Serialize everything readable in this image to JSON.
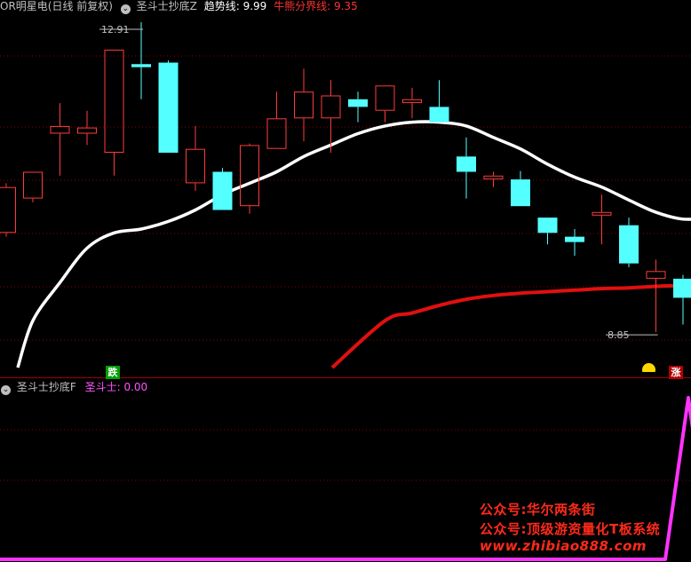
{
  "header": {
    "main": {
      "stock_title": "OR明星电(日线 前复权)",
      "indicator_name": "圣斗士抄底Z",
      "trend_label": "趋势线:",
      "trend_value": "9.99",
      "bull_bear_label": "牛熊分界线:",
      "bull_bear_value": "9.35"
    },
    "sub": {
      "indicator_name": "圣斗士抄底F",
      "series_label": "圣斗士:",
      "series_value": "0.00"
    }
  },
  "markers": {
    "drop": "跌",
    "rise": "涨"
  },
  "watermark": {
    "line1": "公众号:华尔两条街",
    "line2": "公众号:顶级游资量化T板系统",
    "line3": "www.zhibiao888.com"
  },
  "colors": {
    "background": "#000000",
    "up_candle": "#ff3b3b",
    "down_candle": "#54ffff",
    "trend_line": "#ffffff",
    "bull_bear_line": "#e01010",
    "signal_line": "#ff33ff",
    "grid": "#8b0000",
    "label_gray": "#c0c0c0",
    "label_white": "#ffffff",
    "label_red": "#ff3333",
    "label_magenta": "#ff55ff",
    "drop_marker_bg": "#00a000",
    "rise_marker_bg": "#b00000"
  },
  "chart_data": [
    {
      "type": "candlestick",
      "title": "OR明星电(日线 前复权)",
      "candles": [
        {
          "open": 10.6,
          "close": 10.95,
          "high": 10.95,
          "low": 10.55
        },
        {
          "open": 11.45,
          "close": 11.55,
          "high": 11.85,
          "low": 10.9
        },
        {
          "open": 11.45,
          "close": 11.53,
          "high": 11.75,
          "low": 11.3
        },
        {
          "open": 11.2,
          "close": 12.55,
          "high": 12.55,
          "low": 10.9
        },
        {
          "open": 12.36,
          "close": 12.32,
          "high": 12.91,
          "low": 11.9
        },
        {
          "open": 12.38,
          "close": 11.2,
          "high": 12.41,
          "low": 11.2
        },
        {
          "open": 10.8,
          "close": 11.25,
          "high": 11.55,
          "low": 10.7
        },
        {
          "open": 10.95,
          "close": 10.45,
          "high": 11.0,
          "low": 10.45
        },
        {
          "open": 10.5,
          "close": 11.3,
          "high": 11.32,
          "low": 10.4
        },
        {
          "open": 11.25,
          "close": 11.65,
          "high": 12.0,
          "low": 11.25
        },
        {
          "open": 11.65,
          "close": 12.0,
          "high": 12.3,
          "low": 11.35
        },
        {
          "open": 11.65,
          "close": 11.95,
          "high": 12.15,
          "low": 11.2
        },
        {
          "open": 11.9,
          "close": 11.8,
          "high": 12.0,
          "low": 11.6
        },
        {
          "open": 11.75,
          "close": 12.08,
          "high": 12.08,
          "low": 11.6
        },
        {
          "open": 11.85,
          "close": 11.9,
          "high": 12.05,
          "low": 11.65
        },
        {
          "open": 11.8,
          "close": 11.6,
          "high": 12.15,
          "low": 11.6
        },
        {
          "open": 11.15,
          "close": 10.95,
          "high": 11.4,
          "low": 10.6
        },
        {
          "open": 10.85,
          "close": 10.9,
          "high": 10.95,
          "low": 10.75
        },
        {
          "open": 10.85,
          "close": 10.5,
          "high": 10.96,
          "low": 10.5
        },
        {
          "open": 10.35,
          "close": 10.15,
          "high": 10.35,
          "low": 10.0
        },
        {
          "open": 10.1,
          "close": 10.03,
          "high": 10.2,
          "low": 9.85
        },
        {
          "open": 10.4,
          "close": 10.4,
          "high": 10.65,
          "low": 10.0
        },
        {
          "open": 10.25,
          "close": 9.75,
          "high": 10.35,
          "low": 9.7
        },
        {
          "open": 9.55,
          "close": 9.65,
          "high": 9.8,
          "low": 8.85
        },
        {
          "open": 9.55,
          "close": 9.3,
          "high": 9.6,
          "low": 8.95
        },
        {
          "open": 9.4,
          "close": 9.75,
          "high": 10.05,
          "low": 9.25
        },
        {
          "open": 9.7,
          "close": 10.5,
          "high": 10.55,
          "low": 9.7
        }
      ],
      "edge_candle_left": {
        "open": 10.15,
        "close": 10.75,
        "high": 10.8,
        "low": 10.1
      },
      "lines": [
        {
          "name": "趋势线",
          "values": [
            9.0,
            9.5,
            9.95,
            10.15,
            10.2,
            10.3,
            10.45,
            10.65,
            10.8,
            10.95,
            11.15,
            11.3,
            11.45,
            11.55,
            11.6,
            11.6,
            11.55,
            11.4,
            11.25,
            11.05,
            10.88,
            10.75,
            10.58,
            10.42,
            10.33,
            10.35,
            10.38
          ]
        },
        {
          "name": "牛熊分界线",
          "values": [
            9.0,
            9.1,
            9.2,
            9.28,
            9.33,
            9.36,
            9.38,
            9.4,
            9.42,
            9.43,
            9.45,
            9.46,
            9.47,
            9.5
          ]
        }
      ],
      "annotations": {
        "high_label": "12.91",
        "low_label": "8.85"
      }
    },
    {
      "type": "line",
      "title": "圣斗士抄底F",
      "series": [
        {
          "name": "圣斗士",
          "values": [
            0,
            0,
            0,
            0,
            0,
            0,
            0,
            0,
            0,
            0,
            0,
            0,
            0,
            0,
            0,
            0,
            0,
            0,
            0,
            0,
            0,
            0,
            0,
            0,
            100,
            0,
            0
          ]
        }
      ]
    }
  ]
}
